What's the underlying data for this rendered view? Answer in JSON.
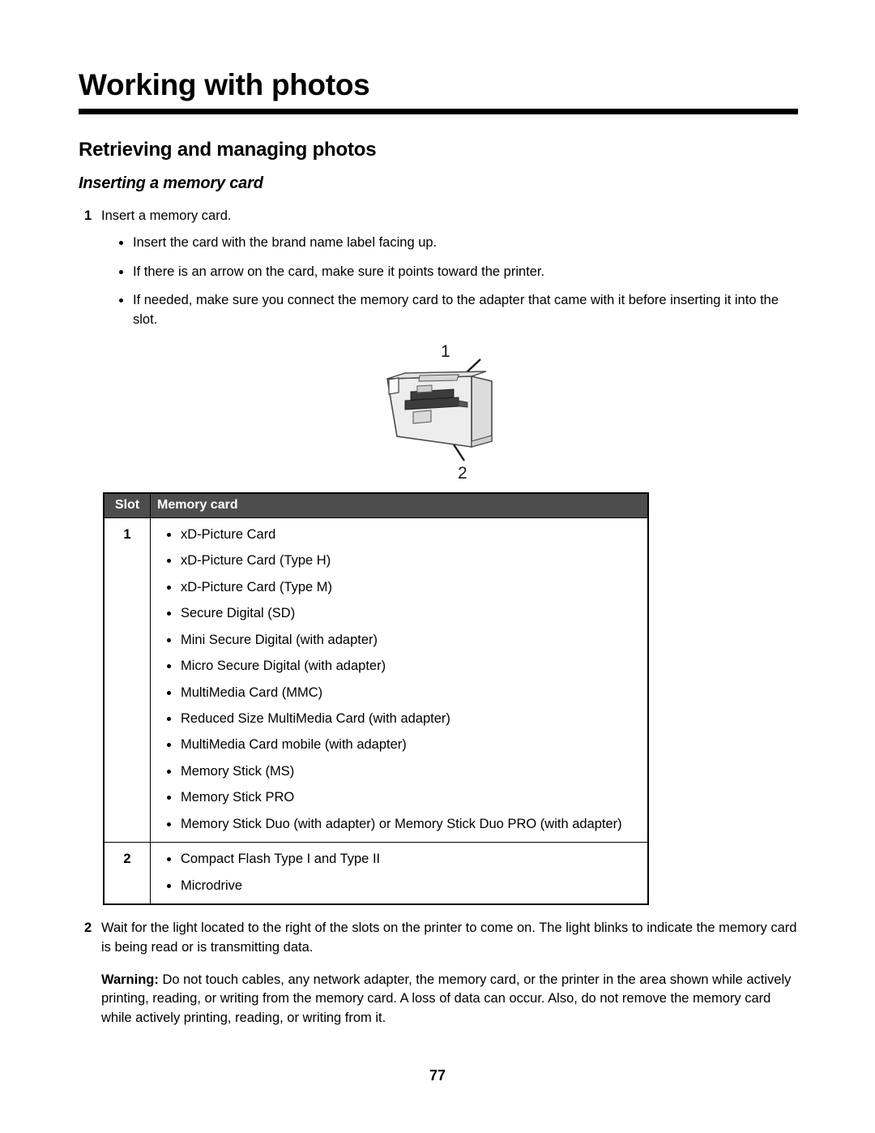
{
  "document": {
    "chapter_title": "Working with photos",
    "section_title": "Retrieving and managing photos",
    "subsection_title": "Inserting a memory card",
    "page_number": "77"
  },
  "steps": [
    {
      "number": "1",
      "text": "Insert a memory card.",
      "bullets": [
        "Insert the card with the brand name label facing up.",
        "If there is an arrow on the card, make sure it points toward the printer.",
        "If needed, make sure you connect the memory card to the adapter that came with it before inserting it into the slot."
      ]
    },
    {
      "number": "2",
      "text": "Wait for the light located to the right of the slots on the printer to come on. The light blinks to indicate the memory card is being read or is transmitting data."
    }
  ],
  "figure": {
    "alt": "printer-memory-card-slots-illustration",
    "callout_1": "1",
    "callout_2": "2"
  },
  "table": {
    "headers": {
      "slot": "Slot",
      "memory_card": "Memory card"
    },
    "rows": [
      {
        "slot": "1",
        "cards": [
          "xD-Picture Card",
          "xD-Picture Card (Type H)",
          "xD-Picture Card (Type M)",
          "Secure Digital (SD)",
          "Mini Secure Digital (with adapter)",
          "Micro Secure Digital (with adapter)",
          "MultiMedia Card (MMC)",
          "Reduced Size MultiMedia Card (with adapter)",
          "MultiMedia Card mobile (with adapter)",
          "Memory Stick (MS)",
          "Memory Stick PRO",
          "Memory Stick Duo (with adapter) or Memory Stick Duo PRO (with adapter)"
        ]
      },
      {
        "slot": "2",
        "cards": [
          "Compact Flash Type I and Type II",
          "Microdrive"
        ]
      }
    ]
  },
  "warning": {
    "label": "Warning:",
    "text": " Do not touch cables, any network adapter, the memory card, or the printer in the area shown while actively printing, reading, or writing from the memory card. A loss of data can occur. Also, do not remove the memory card while actively printing, reading, or writing from it."
  },
  "colors": {
    "table_header_bg": "#4d4d4d",
    "table_header_text": "#ffffff",
    "rule": "#000000",
    "printer_body": "#e8e8e8",
    "printer_side": "#d2d2d2",
    "slot_dark": "#3c3c3c"
  }
}
